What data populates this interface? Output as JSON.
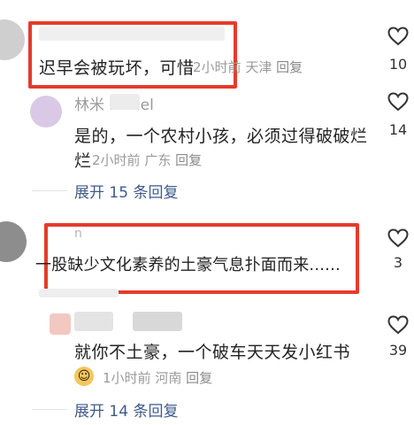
{
  "comment1": {
    "text": "迟早会被玩坏，可惜",
    "time": "2小时前",
    "location": "天津",
    "reply_label": "回复",
    "likes": "10"
  },
  "reply1": {
    "username": "林米 ichael",
    "text_line1": "是的，一个农村小孩，必须过得破破烂",
    "text_line2": "烂",
    "time": "2小时前",
    "location": "广东",
    "reply_label": "回复",
    "likes": "14"
  },
  "expand1": {
    "label": "展开 15 条回复"
  },
  "comment2": {
    "username": "n",
    "text": "一股缺少文化素养的土豪气息扑面而来......",
    "likes": "3"
  },
  "reply2": {
    "text": "就你不土豪，一个破车天天发小红书",
    "time": "1小时前",
    "location": "河南",
    "reply_label": "回复",
    "likes": "39"
  },
  "expand2": {
    "label": "展开 14 条回复"
  },
  "colors": {
    "highlight": "#e53b2c",
    "link": "#3f5a8a"
  },
  "icons": [
    "heart-icon",
    "emoji-badge-icon"
  ]
}
